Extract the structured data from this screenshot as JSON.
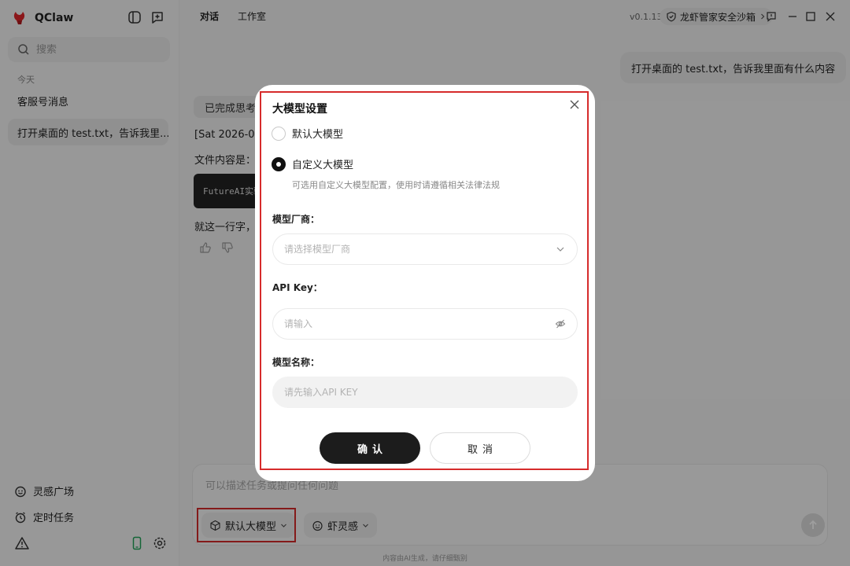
{
  "app": {
    "name": "QClaw",
    "version": "v0.1.13",
    "security_badge": "龙虾管家安全沙箱"
  },
  "sidebar": {
    "search_placeholder": "搜索",
    "section_today": "今天",
    "conversations": [
      {
        "title": "客服号消息",
        "active": false
      },
      {
        "title": "打开桌面的 test.txt，告诉我里...",
        "active": true
      }
    ],
    "bottom_items": [
      {
        "label": "灵感广场",
        "icon": "sparkle-face-icon"
      },
      {
        "label": "定时任务",
        "icon": "alarm-clock-icon"
      }
    ]
  },
  "header": {
    "tabs": [
      {
        "label": "对话",
        "active": true
      },
      {
        "label": "工作室",
        "active": false
      }
    ]
  },
  "chat": {
    "user_message": "打开桌面的 test.txt，告诉我里面有什么内容",
    "thought_chip": "已完成思考",
    "line_timestamp": "[Sat 2026-03-",
    "line_file_content": "文件内容是：",
    "code_snippet": "FutureAI实验",
    "line_summary": "就这一行字，"
  },
  "composer": {
    "placeholder": "可以描述任务或提问任何问题",
    "model_chip": "默认大模型",
    "inspiration_chip": "虾灵感",
    "footer_note": "内容由AI生成，请仔细甄别"
  },
  "modal": {
    "title": "大模型设置",
    "option_default": "默认大模型",
    "option_custom": "自定义大模型",
    "selected": "custom",
    "custom_hint": "可选用自定义大模型配置，使用时请遵循相关法律法规",
    "vendor_label": "模型厂商：",
    "vendor_placeholder": "请选择模型厂商",
    "apikey_label": "API Key：",
    "apikey_placeholder": "请输入",
    "model_name_label": "模型名称：",
    "model_name_placeholder": "请先输入API KEY",
    "confirm_label": "确认",
    "cancel_label": "取消"
  },
  "colors": {
    "highlight_red": "#d62b2b",
    "primary_dark": "#1c1c1c",
    "brand_red": "#e0262a"
  }
}
